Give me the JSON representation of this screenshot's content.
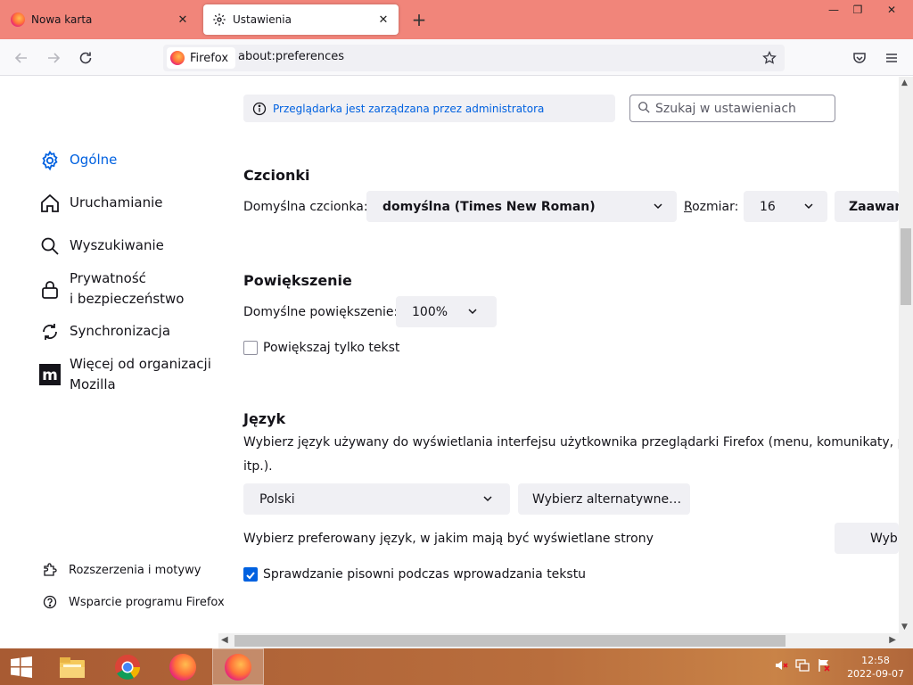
{
  "browser": {
    "tabs": [
      {
        "label": "Nowa karta",
        "icon": "firefox-icon",
        "active": false
      },
      {
        "label": "Ustawienia",
        "icon": "gear-icon",
        "active": true
      }
    ],
    "identity_label": "Firefox",
    "url": "about:preferences",
    "accent_color": "#f1857a"
  },
  "sidebar": {
    "categories": [
      {
        "label": "Ogólne",
        "icon": "gear-icon",
        "selected": true
      },
      {
        "label": "Uruchamianie",
        "icon": "home-icon"
      },
      {
        "label": "Wyszukiwanie",
        "icon": "search-icon"
      },
      {
        "label_line1": "Prywatność",
        "label_line2": "i bezpieczeństwo",
        "icon": "lock-icon"
      },
      {
        "label": "Synchronizacja",
        "icon": "sync-icon"
      },
      {
        "label_line1": "Więcej od organizacji",
        "label_line2": "Mozilla",
        "icon": "mozilla-icon"
      }
    ],
    "bottom_links": [
      {
        "label": "Rozszerzenia i motywy",
        "icon": "puzzle-icon"
      },
      {
        "label": "Wsparcie programu Firefox",
        "icon": "help-icon"
      }
    ]
  },
  "main": {
    "policy_banner": "Przeglądarka jest zarządzana przez administratora",
    "search_placeholder": "Szukaj w ustawieniach",
    "fonts": {
      "heading": "Czcionki",
      "default_font_label": "Domyślna czcionka:",
      "default_font_value": "domyślna (Times New Roman)",
      "size_label": "Rozmiar:",
      "size_value": "16",
      "advanced_button": "Zaawansowane…"
    },
    "zoom": {
      "heading": "Powiększenie",
      "default_zoom_label": "Domyślne powiększenie:",
      "default_zoom_value": "100%",
      "text_only_label": "Powiększaj tylko tekst",
      "text_only_checked": false
    },
    "language": {
      "heading": "Język",
      "description_line1": "Wybierz język używany do wyświetlania interfejsu użytkownika przeglądarki Firefox (menu, komunikaty, powiadomienia itp.).",
      "description_line2": "itp.).",
      "language_value": "Polski",
      "choose_alternatives_button": "Wybierz alternatywne…",
      "preferred_language_label": "Wybierz preferowany język, w jakim mają być wyświetlane strony",
      "choose_button": "Wybierz…",
      "spellcheck_label": "Sprawdzanie pisowni podczas wprowadzania tekstu",
      "spellcheck_checked": true
    }
  },
  "taskbar": {
    "time": "12:58",
    "date": "2022-09-07"
  }
}
